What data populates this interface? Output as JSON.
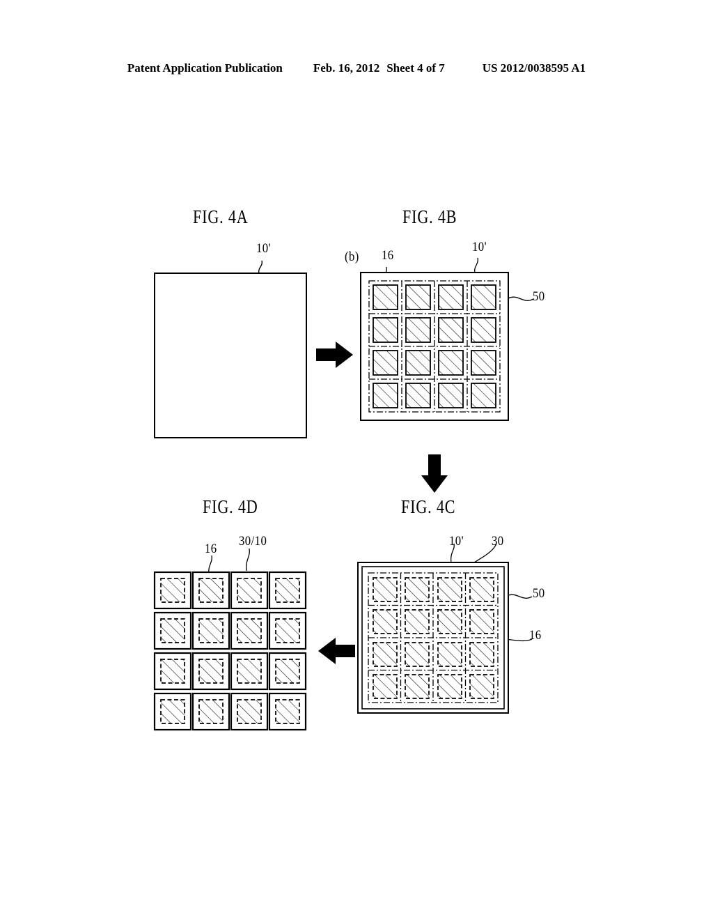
{
  "header": {
    "publication": "Patent Application Publication",
    "date": "Feb. 16, 2012",
    "sheet": "Sheet 4 of 7",
    "number": "US 2012/0038595 A1"
  },
  "figures": [
    {
      "id": "fig4a",
      "title": "FIG. 4A",
      "description": "blank-wafer-square",
      "labels": [
        {
          "name": "ref-10-prime",
          "text": "10'"
        }
      ]
    },
    {
      "id": "fig4b",
      "title": "FIG. 4B",
      "description": "wafer-with-4x4-die-array-and-scribe-lines",
      "grid": {
        "rows": 4,
        "cols": 4
      },
      "labels": [
        {
          "name": "ref-b",
          "text": "(b)"
        },
        {
          "name": "ref-16",
          "text": "16"
        },
        {
          "name": "ref-10-prime",
          "text": "10'"
        },
        {
          "name": "ref-50",
          "text": "50"
        }
      ]
    },
    {
      "id": "fig4c",
      "title": "FIG. 4C",
      "description": "wafer-with-layer-30-over-4x4-die-array",
      "grid": {
        "rows": 4,
        "cols": 4
      },
      "labels": [
        {
          "name": "ref-10-prime",
          "text": "10'"
        },
        {
          "name": "ref-30",
          "text": "30"
        },
        {
          "name": "ref-50",
          "text": "50"
        },
        {
          "name": "ref-16",
          "text": "16"
        }
      ]
    },
    {
      "id": "fig4d",
      "title": "FIG. 4D",
      "description": "singulated-individual-dies-4x4",
      "grid": {
        "rows": 4,
        "cols": 4
      },
      "labels": [
        {
          "name": "ref-16",
          "text": "16"
        },
        {
          "name": "ref-30-10",
          "text": "30/10"
        }
      ]
    }
  ],
  "arrows": [
    {
      "name": "arrow-4a-to-4b",
      "direction": "right"
    },
    {
      "name": "arrow-4b-to-4c",
      "direction": "down"
    },
    {
      "name": "arrow-4c-to-4d",
      "direction": "left"
    }
  ],
  "colors": {
    "ink": "#000000",
    "paper": "#ffffff"
  }
}
